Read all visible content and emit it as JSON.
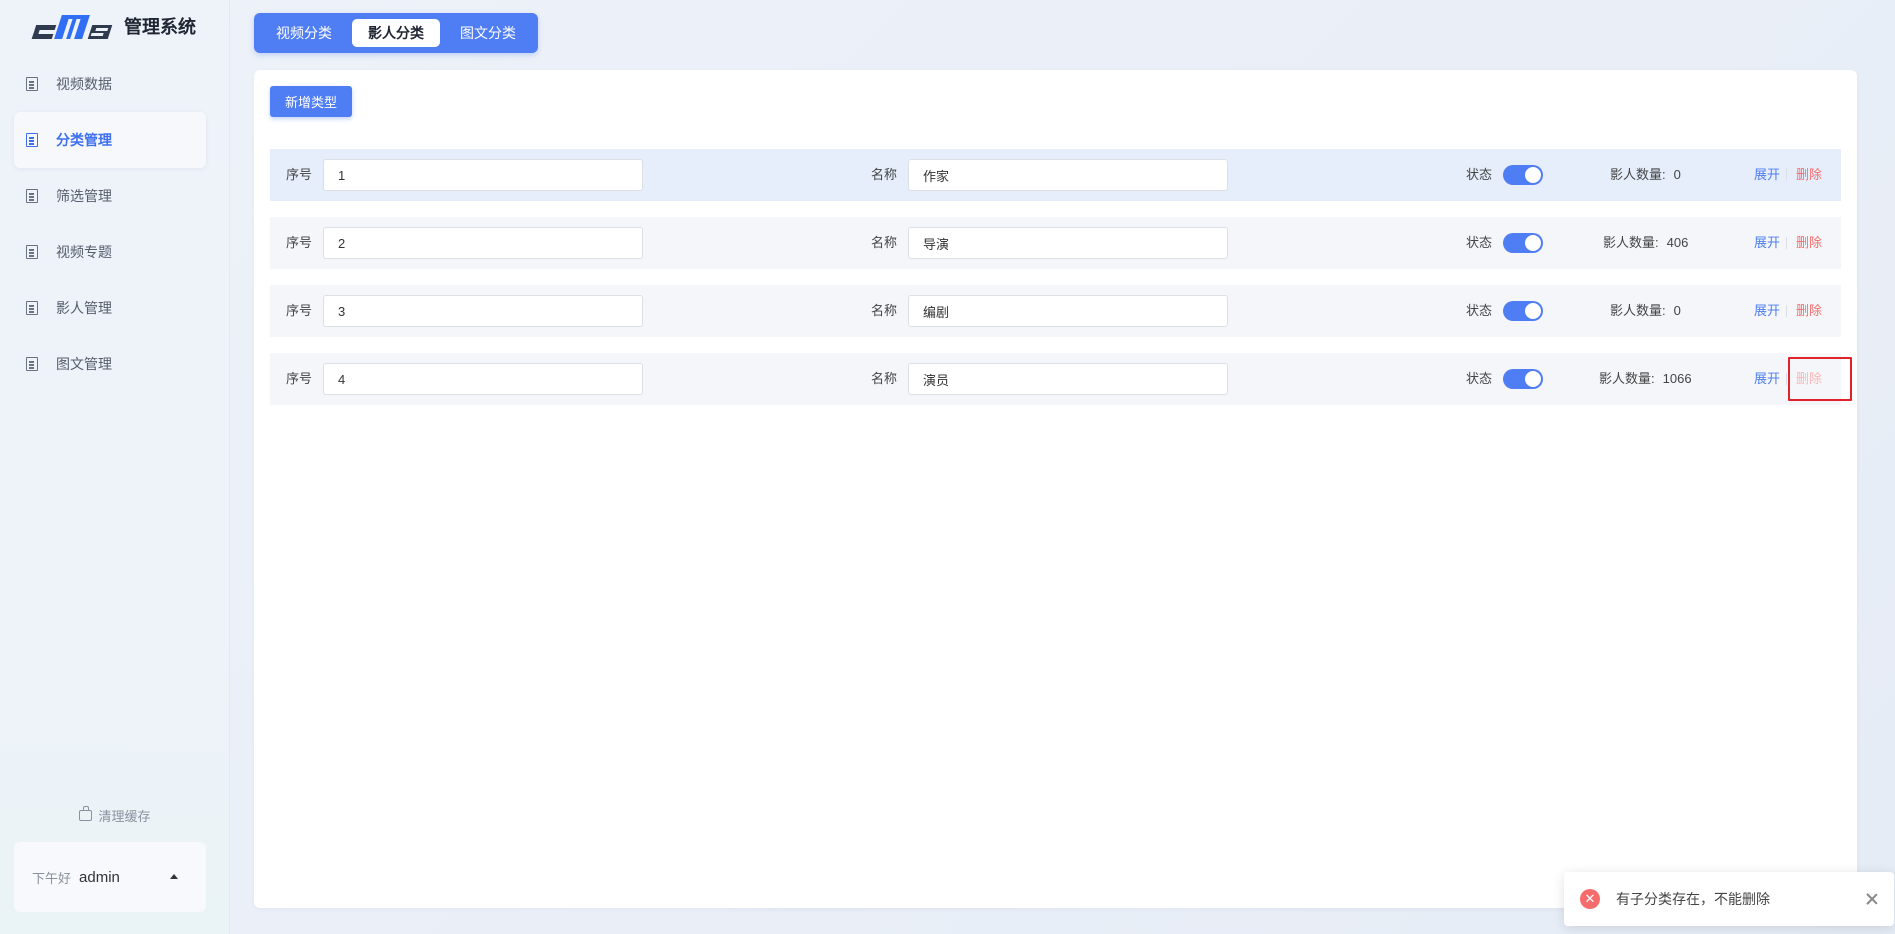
{
  "app": {
    "logo_text": "管理系统"
  },
  "sidebar": {
    "items": [
      {
        "label": "视频数据",
        "icon": "document-icon"
      },
      {
        "label": "分类管理",
        "icon": "document-icon",
        "active": true
      },
      {
        "label": "筛选管理",
        "icon": "document-icon"
      },
      {
        "label": "视频专题",
        "icon": "document-icon"
      },
      {
        "label": "影人管理",
        "icon": "document-icon"
      },
      {
        "label": "图文管理",
        "icon": "document-icon"
      }
    ],
    "clear_cache": "清理缓存",
    "user": {
      "greeting": "下午好",
      "name": "admin"
    }
  },
  "tabs": [
    {
      "label": "视频分类"
    },
    {
      "label": "影人分类",
      "active": true
    },
    {
      "label": "图文分类"
    }
  ],
  "toolbar": {
    "add_label": "新增类型"
  },
  "labels": {
    "order": "序号",
    "name": "名称",
    "status": "状态",
    "count": "影人数量:",
    "expand": "展开",
    "delete": "删除"
  },
  "rows": [
    {
      "order": "1",
      "name": "作家",
      "status": true,
      "count": "0"
    },
    {
      "order": "2",
      "name": "导演",
      "status": true,
      "count": "406"
    },
    {
      "order": "3",
      "name": "编剧",
      "status": true,
      "count": "0"
    },
    {
      "order": "4",
      "name": "演员",
      "status": true,
      "count": "1066"
    }
  ],
  "toast": {
    "message": "有子分类存在，不能删除",
    "type": "error"
  },
  "colors": {
    "primary": "#4f7df3",
    "danger": "#f56c6c"
  }
}
